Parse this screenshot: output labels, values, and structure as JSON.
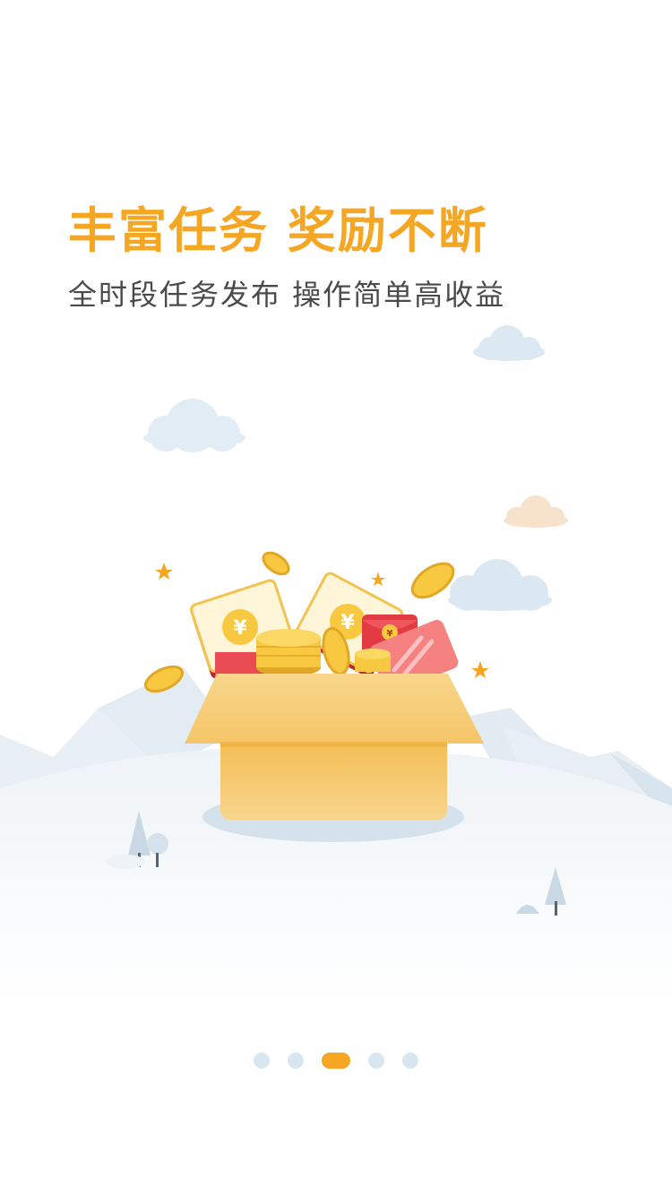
{
  "onboarding": {
    "headline": "丰富任务  奖励不断",
    "subline": "全时段任务发布  操作简单高收益"
  },
  "pager": {
    "total": 5,
    "active_index": 2
  },
  "colors": {
    "accent": "#f5a623",
    "subtext": "#4a4a4a",
    "dot_inactive": "#d8e7ef",
    "cloud": "#dde9f2",
    "cloud_warm": "#f7e2cc",
    "box_top": "#f7d68a",
    "box_body": "#f2b640",
    "red_packet": "#e94b52",
    "coin": "#f8c940"
  },
  "icons": {
    "coin_symbol": "¥",
    "sparkle": "✦"
  }
}
